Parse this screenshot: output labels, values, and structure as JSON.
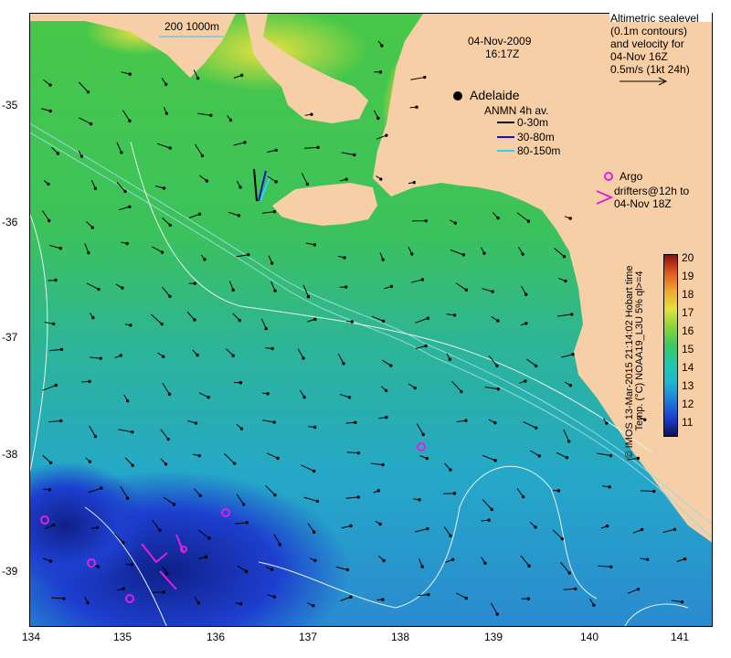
{
  "map": {
    "date": "04-Nov-2009",
    "time": "16:17Z",
    "scale_label": "200  1000m",
    "city_label": "Adelaide",
    "altimetry_legend": [
      "Altimetric sealevel",
      "(0.1m contours)",
      "and velocity for",
      "04-Nov 16Z",
      "0.5m/s (1kt 24h)"
    ],
    "anmn_legend": {
      "title": "ANMN 4h av.",
      "items": [
        {
          "label": "0-30m",
          "color": "#000000"
        },
        {
          "label": "30-80m",
          "color": "#1010d0"
        },
        {
          "label": "80-150m",
          "color": "#30d0f0"
        }
      ]
    },
    "argo_legend": [
      "Argo",
      "drifters@12h to",
      "04-Nov 18Z"
    ],
    "argo_color": "#e020e0",
    "lat_ticks": [
      "-35",
      "-36",
      "-37",
      "-38",
      "-39"
    ],
    "lon_ticks": [
      "134",
      "135",
      "136",
      "137",
      "138",
      "139",
      "140",
      "141"
    ],
    "colorbar": {
      "ticks": [
        "20",
        "19",
        "18",
        "17",
        "16",
        "15",
        "14",
        "13",
        "12",
        "11"
      ],
      "label": "Temp. (°C) NOAA19_L3U 5% ql>=4"
    },
    "credit": "© IMOS 13-Mar-2015 21:14:02 Hobart time",
    "colors": {
      "land": "#f7cfa6",
      "ocean": "#3cc45a",
      "deep_blue": "#1d3fcf"
    }
  }
}
